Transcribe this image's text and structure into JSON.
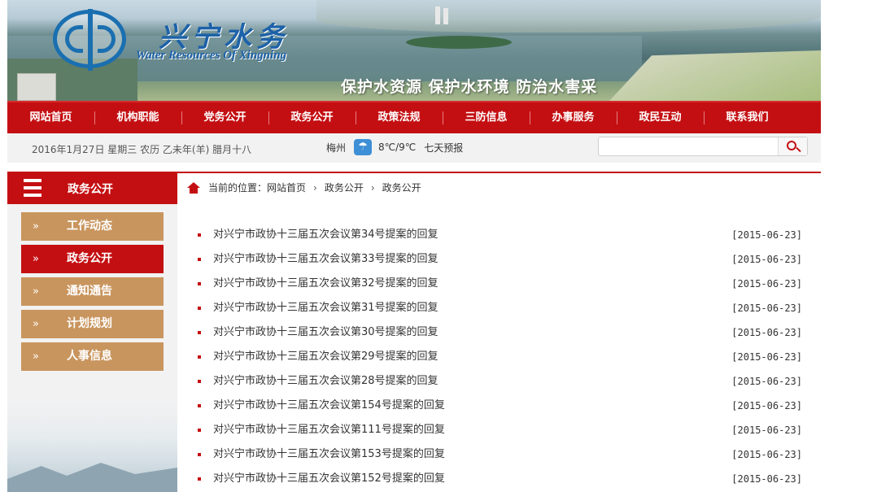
{
  "header": {
    "logo_cn": "兴宁水务",
    "logo_en": "Water Resources Of Xingning",
    "slogan": "保护水资源 保护水环境 防治水害采"
  },
  "nav": {
    "items": [
      {
        "label": "网站首页"
      },
      {
        "label": "机构职能"
      },
      {
        "label": "党务公开"
      },
      {
        "label": "政务公开"
      },
      {
        "label": "政策法规"
      },
      {
        "label": "三防信息"
      },
      {
        "label": "办事服务"
      },
      {
        "label": "政民互动"
      },
      {
        "label": "联系我们"
      }
    ]
  },
  "infobar": {
    "date": "2016年1月27日 星期三 农历 乙未年(羊) 腊月十八",
    "weather_city": "梅州",
    "weather_icon": "rain-cloud-icon",
    "weather_temp": "8℃/9℃",
    "weather_forecast": "七天预报",
    "search_value": ""
  },
  "sidebar": {
    "title": "政务公开",
    "items": [
      {
        "label": "工作动态",
        "active": false
      },
      {
        "label": "政务公开",
        "active": true
      },
      {
        "label": "通知通告",
        "active": false
      },
      {
        "label": "计划规划",
        "active": false
      },
      {
        "label": "人事信息",
        "active": false
      }
    ]
  },
  "breadcrumb": {
    "prefix": "当前的位置：",
    "items": [
      "网站首页",
      "政务公开",
      "政务公开"
    ]
  },
  "articles": [
    {
      "title": "对兴宁市政协十三届五次会议第34号提案的回复",
      "date": "[2015-06-23]"
    },
    {
      "title": "对兴宁市政协十三届五次会议第33号提案的回复",
      "date": "[2015-06-23]"
    },
    {
      "title": "对兴宁市政协十三届五次会议第32号提案的回复",
      "date": "[2015-06-23]"
    },
    {
      "title": "对兴宁市政协十三届五次会议第31号提案的回复",
      "date": "[2015-06-23]"
    },
    {
      "title": "对兴宁市政协十三届五次会议第30号提案的回复",
      "date": "[2015-06-23]"
    },
    {
      "title": "对兴宁市政协十三届五次会议第29号提案的回复",
      "date": "[2015-06-23]"
    },
    {
      "title": "对兴宁市政协十三届五次会议第28号提案的回复",
      "date": "[2015-06-23]"
    },
    {
      "title": "对兴宁市政协十三届五次会议第154号提案的回复",
      "date": "[2015-06-23]"
    },
    {
      "title": "对兴宁市政协十三届五次会议第111号提案的回复",
      "date": "[2015-06-23]"
    },
    {
      "title": "对兴宁市政协十三届五次会议第153号提案的回复",
      "date": "[2015-06-23]"
    },
    {
      "title": "对兴宁市政协十三届五次会议第152号提案的回复",
      "date": "[2015-06-23]"
    }
  ],
  "colors": {
    "brand_red": "#c40f12",
    "sidebar_tan": "#c9955e",
    "logo_blue": "#1d62a8"
  }
}
